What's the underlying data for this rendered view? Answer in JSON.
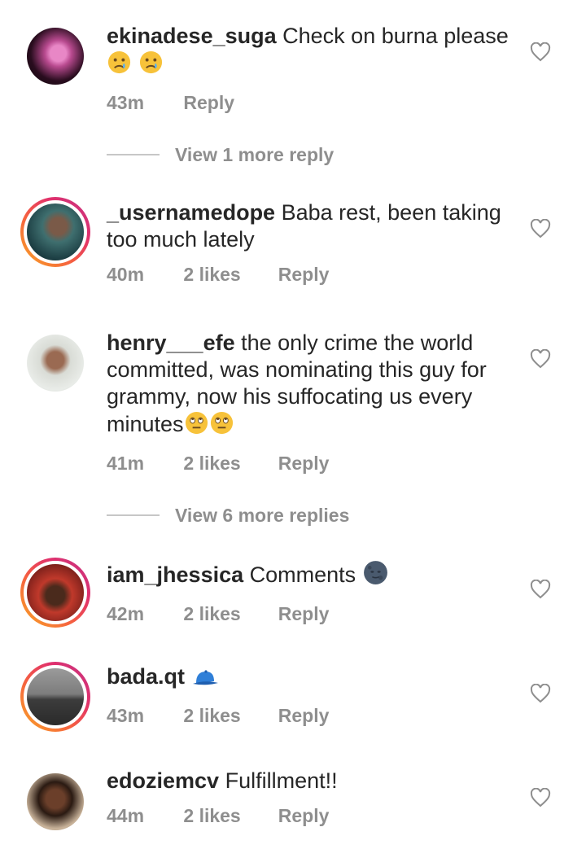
{
  "comments": [
    {
      "username": "ekinadese_suga",
      "text": "Check on burna please",
      "time": "43m",
      "likes": "",
      "reply": "Reply",
      "emoji": "crying-emoji crying-emoji"
    },
    {
      "username": "_usernamedope",
      "text": "Baba rest, been taking too much lately",
      "time": "40m",
      "likes": "2 likes",
      "reply": "Reply"
    },
    {
      "username": "henry___efe",
      "text": "the only crime the world committed, was nominating this guy for grammy, now his suffocating us every minutes",
      "time": "41m",
      "likes": "2 likes",
      "reply": "Reply",
      "emoji": "eye-roll-emoji eye-roll-emoji"
    },
    {
      "username": "iam_jhessica",
      "text": "Comments",
      "time": "42m",
      "likes": "2 likes",
      "reply": "Reply",
      "emoji": "new-moon-face-emoji"
    },
    {
      "username": "bada.qt",
      "text": "",
      "time": "43m",
      "likes": "2 likes",
      "reply": "Reply",
      "emoji": "blue-cap-emoji"
    },
    {
      "username": "edoziemcv",
      "text": "Fulfillment!!",
      "time": "44m",
      "likes": "2 likes",
      "reply": "Reply"
    }
  ],
  "view_more": [
    {
      "label": "View 1 more reply"
    },
    {
      "label": "View 6 more replies"
    }
  ],
  "colors": {
    "text": "#262626",
    "secondary": "#8e8e8e",
    "ring_start": "#f9a825",
    "ring_end": "#c13584"
  }
}
